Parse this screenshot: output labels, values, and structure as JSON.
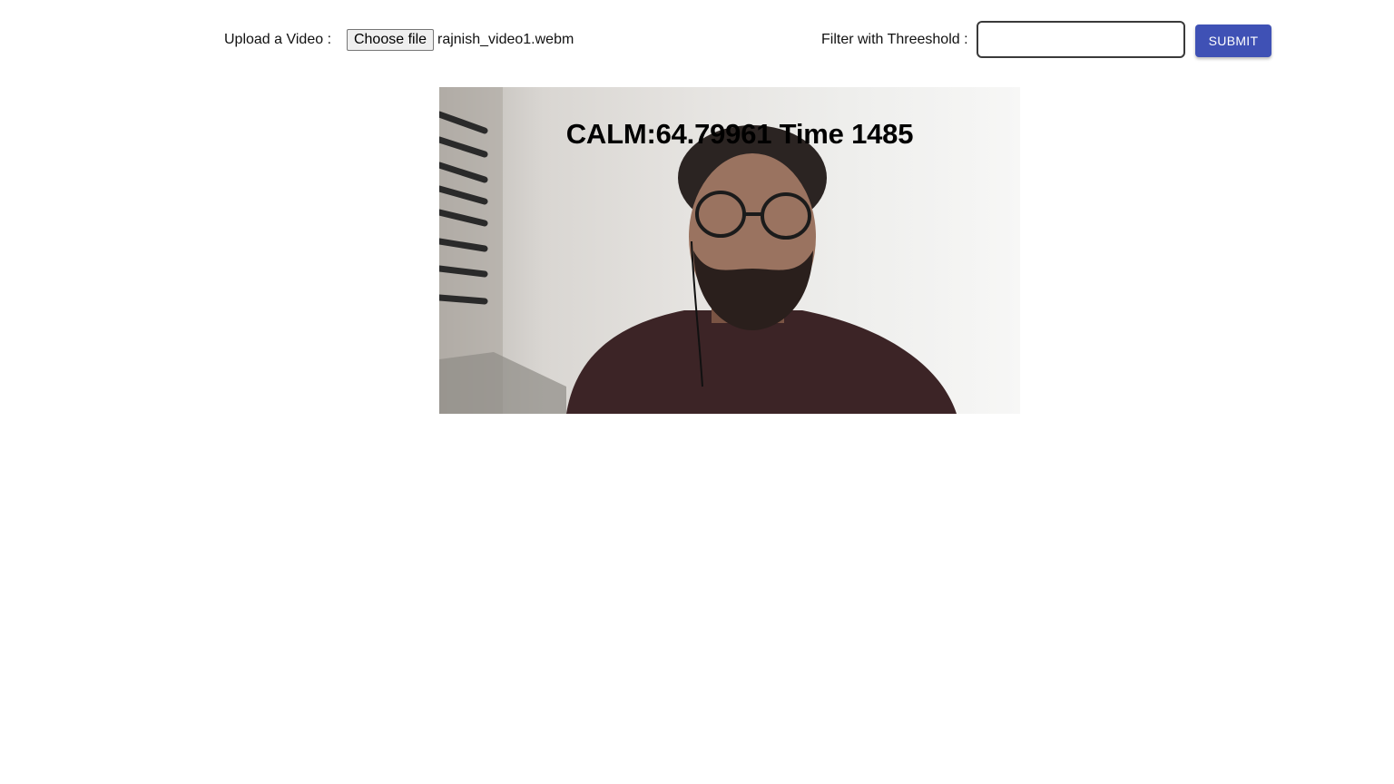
{
  "upload": {
    "label": "Upload a Video :",
    "button_label": "Choose file",
    "file_name": "rajnish_video1.webm"
  },
  "filter": {
    "label": "Filter with Threeshold :",
    "value": ""
  },
  "submit": {
    "label": "SUBMIT"
  },
  "video": {
    "overlay_text": "CALM:64.79961 Time 1485"
  },
  "colors": {
    "accent": "#3f51b5"
  }
}
